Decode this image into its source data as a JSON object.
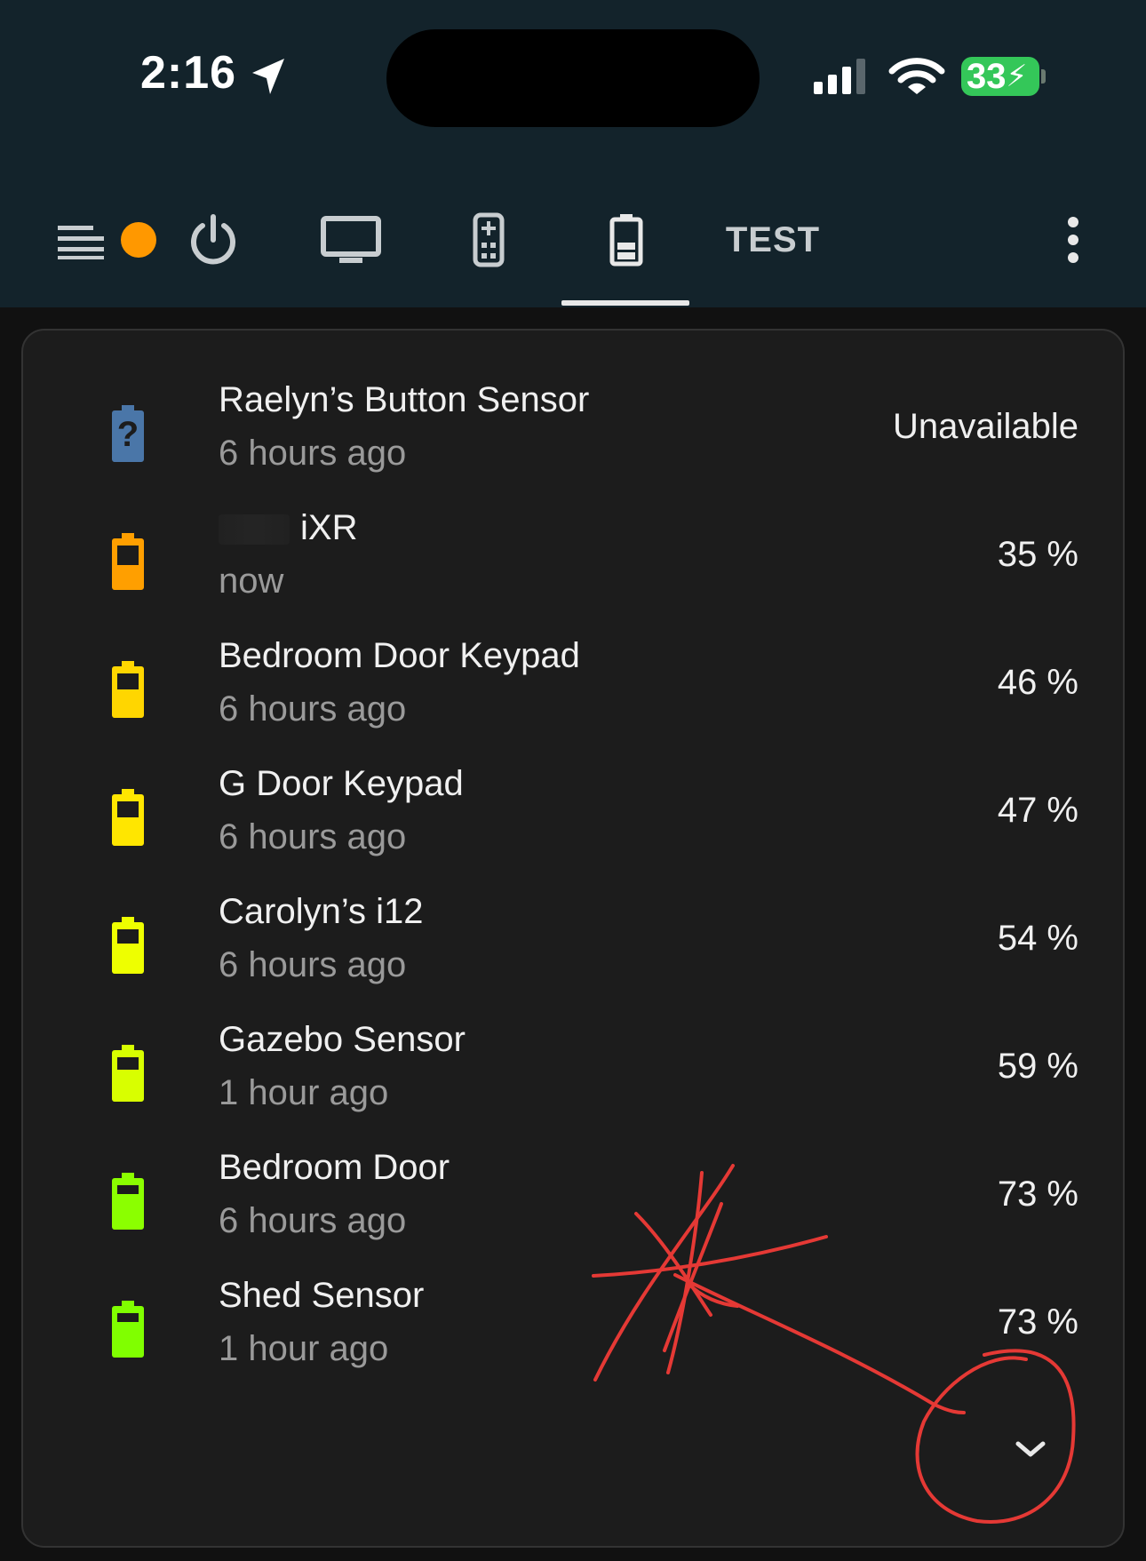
{
  "status_bar": {
    "time": "2:16",
    "battery_level": "33"
  },
  "toolbar": {
    "test_tab_label": "TEST",
    "active_tab": "battery"
  },
  "colors": {
    "header_bg": "#13232b",
    "card_bg": "#1c1c1c",
    "notification_dot": "#ff9800",
    "battery_status": "#34c759",
    "annotation_red": "#e53935"
  },
  "devices": [
    {
      "name": "Raelyn’s Button Sensor",
      "time": "6 hours ago",
      "value": "Unavailable",
      "icon": "battery-unknown-icon",
      "color": "#4a76a8"
    },
    {
      "name": "iXR",
      "time": "now",
      "value": "35 %",
      "icon": "battery-icon",
      "color": "#ff9f00"
    },
    {
      "name": "Bedroom Door Keypad",
      "time": "6 hours ago",
      "value": "46 %",
      "icon": "battery-icon",
      "color": "#ffd600"
    },
    {
      "name": "G Door Keypad",
      "time": "6 hours ago",
      "value": "47 %",
      "icon": "battery-icon",
      "color": "#ffe600"
    },
    {
      "name": "Carolyn’s i12",
      "time": "6 hours ago",
      "value": "54 %",
      "icon": "battery-icon",
      "color": "#eeff00"
    },
    {
      "name": "Gazebo Sensor",
      "time": "1 hour ago",
      "value": "59 %",
      "icon": "battery-icon",
      "color": "#d8ff00"
    },
    {
      "name": "Bedroom Door",
      "time": "6 hours ago",
      "value": "73 %",
      "icon": "battery-icon",
      "color": "#8bff00"
    },
    {
      "name": "Shed Sensor",
      "time": "1 hour ago",
      "value": "73 %",
      "icon": "battery-icon",
      "color": "#80ff00"
    }
  ]
}
